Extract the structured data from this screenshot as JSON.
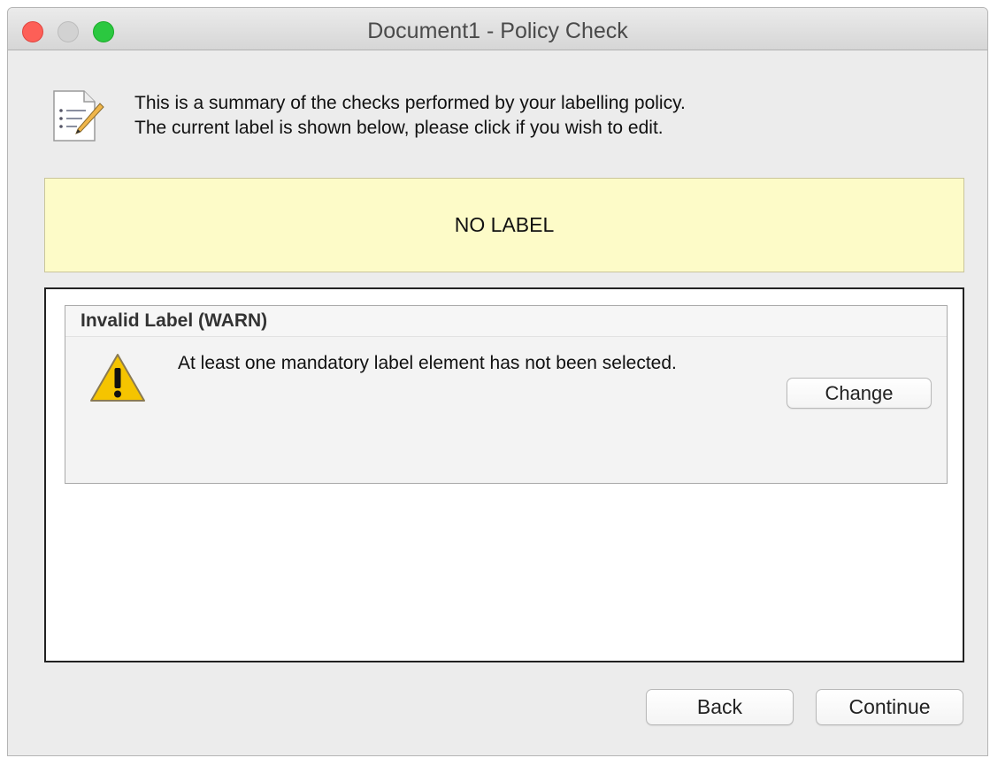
{
  "window": {
    "title": "Document1 - Policy Check"
  },
  "intro": {
    "line1": "This is a summary of the checks performed by your labelling policy.",
    "line2": "The current label is shown below, please click if you wish to edit.",
    "icon": "document-list-pencil-icon"
  },
  "label_banner": {
    "text": "NO LABEL",
    "background": "#fdfbc8"
  },
  "checks": [
    {
      "title": "Invalid Label (WARN)",
      "message": "At least one mandatory label element has not been selected.",
      "icon": "warning-icon",
      "action_label": "Change"
    }
  ],
  "footer": {
    "back_label": "Back",
    "continue_label": "Continue"
  },
  "colors": {
    "close": "#fd5f57",
    "minimize": "#d2d2d2",
    "maximize": "#2bc840",
    "warning": "#f5c400"
  }
}
